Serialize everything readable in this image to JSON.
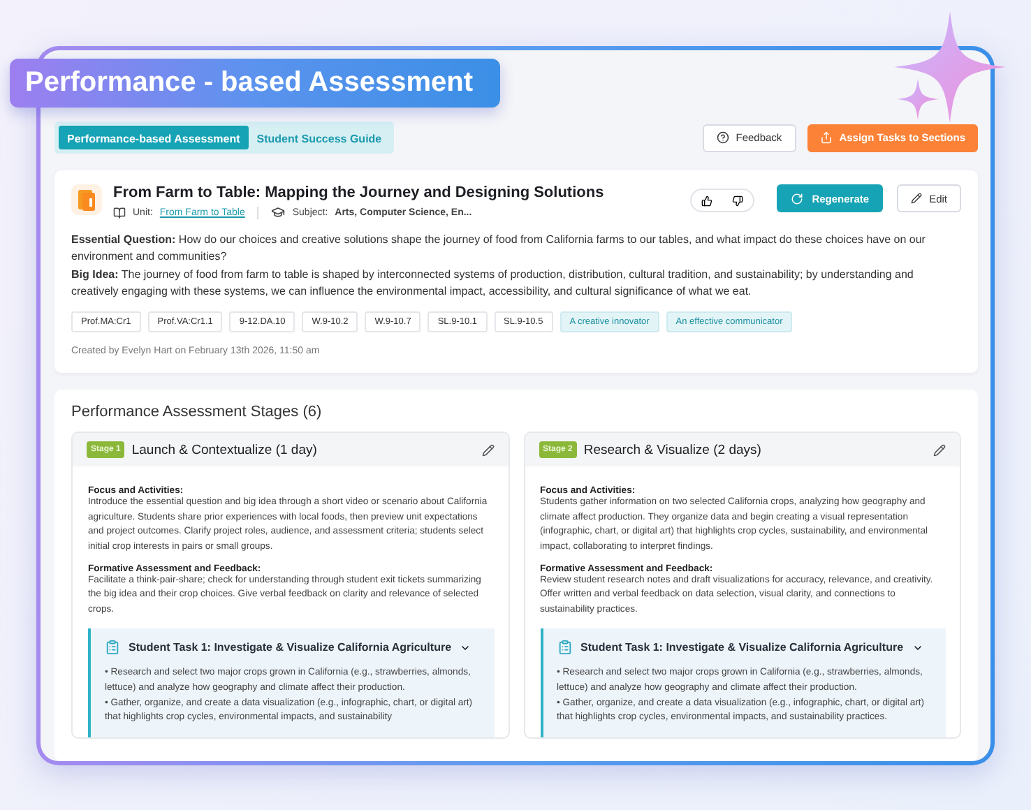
{
  "banner": {
    "title": "Performance - based Assessment"
  },
  "tabs": [
    {
      "label": "Performance-based Assessment",
      "selected": true
    },
    {
      "label": "Student Success Guide",
      "selected": false
    }
  ],
  "actions": {
    "feedback": "Feedback",
    "assign": "Assign Tasks to Sections"
  },
  "lesson": {
    "title": "From Farm to Table: Mapping the Journey and Designing Solutions",
    "unit_label": "Unit:",
    "unit": "From Farm to Table",
    "subject_label": "Subject:",
    "subject": "Arts, Computer Science, En...",
    "regenerate": "Regenerate",
    "edit": "Edit",
    "paragraphs": [
      {
        "label": "Essential Question:",
        "text": "How do our choices and creative solutions shape the journey of food from California farms to our tables, and what impact do these choices have on our environment and communities?"
      },
      {
        "label": "Big Idea:",
        "text": "The journey of food from farm to table is shaped by interconnected systems of production, distribution, cultural tradition, and sustainability; by understanding and creatively engaging with these systems, we can influence the environmental impact, accessibility, and cultural significance of what we eat."
      }
    ],
    "tags": [
      {
        "label": "Prof.MA:Cr1",
        "kind": "standard"
      },
      {
        "label": "Prof.VA:Cr1.1",
        "kind": "standard"
      },
      {
        "label": "9-12.DA.10",
        "kind": "standard"
      },
      {
        "label": "W.9-10.2",
        "kind": "standard"
      },
      {
        "label": "W.9-10.7",
        "kind": "standard"
      },
      {
        "label": "SL.9-10.1",
        "kind": "standard"
      },
      {
        "label": "SL.9-10.5",
        "kind": "standard"
      },
      {
        "label": "A creative innovator",
        "kind": "trait"
      },
      {
        "label": "An effective communicator",
        "kind": "trait"
      }
    ],
    "created": "Created by Evelyn Hart on February 13th 2026, 11:50 am"
  },
  "stages": {
    "title": "Performance Assessment Stages (6)",
    "items": [
      {
        "badge": "Stage 1",
        "title": "Launch & Contextualize (1 day)",
        "sections": [
          {
            "heading": "Focus and Activities:",
            "text": "Introduce the essential question and big idea through a short video or scenario about California agriculture. Students share prior experiences with local foods, then preview unit expectations and project outcomes. Clarify project roles, audience, and assessment criteria; students select initial crop interests in pairs or small groups."
          },
          {
            "heading": "Formative Assessment and Feedback:",
            "text": "Facilitate a think-pair-share; check for understanding through student exit tickets summarizing the big idea and their crop choices. Give verbal feedback on clarity and relevance of selected crops."
          }
        ],
        "task": {
          "title": "Student Task 1: Investigate & Visualize California Agriculture",
          "expanded": true,
          "bullets": [
            "• Research and select two major crops grown in California (e.g., strawberries, almonds, lettuce) and analyze how geography and climate affect their production.",
            "• Gather, organize, and create a data visualization (e.g., infographic, chart, or digital art) that highlights crop cycles, environmental impacts, and sustainability"
          ]
        }
      },
      {
        "badge": "Stage 2",
        "title": "Research & Visualize (2 days)",
        "sections": [
          {
            "heading": "Focus and Activities:",
            "text": "Students gather information on two selected California crops, analyzing how geography and climate affect production. They organize data and begin creating a visual representation (infographic, chart, or digital art) that highlights crop cycles, sustainability, and environmental impact, collaborating to interpret findings."
          },
          {
            "heading": "Formative Assessment and Feedback:",
            "text": "Review student research notes and draft visualizations for accuracy, relevance, and creativity. Offer written and verbal feedback on data selection, visual clarity, and connections to sustainability practices."
          }
        ],
        "task": {
          "title": "Student Task 1: Investigate & Visualize California Agriculture",
          "expanded": true,
          "bullets": [
            "• Research and select two major crops grown in California (e.g., strawberries, almonds, lettuce) and analyze how geography and climate affect their production.",
            "• Gather, organize, and create a data visualization (e.g., infographic, chart, or digital art) that highlights crop cycles, environmental impacts, and sustainability practices."
          ]
        }
      }
    ]
  }
}
